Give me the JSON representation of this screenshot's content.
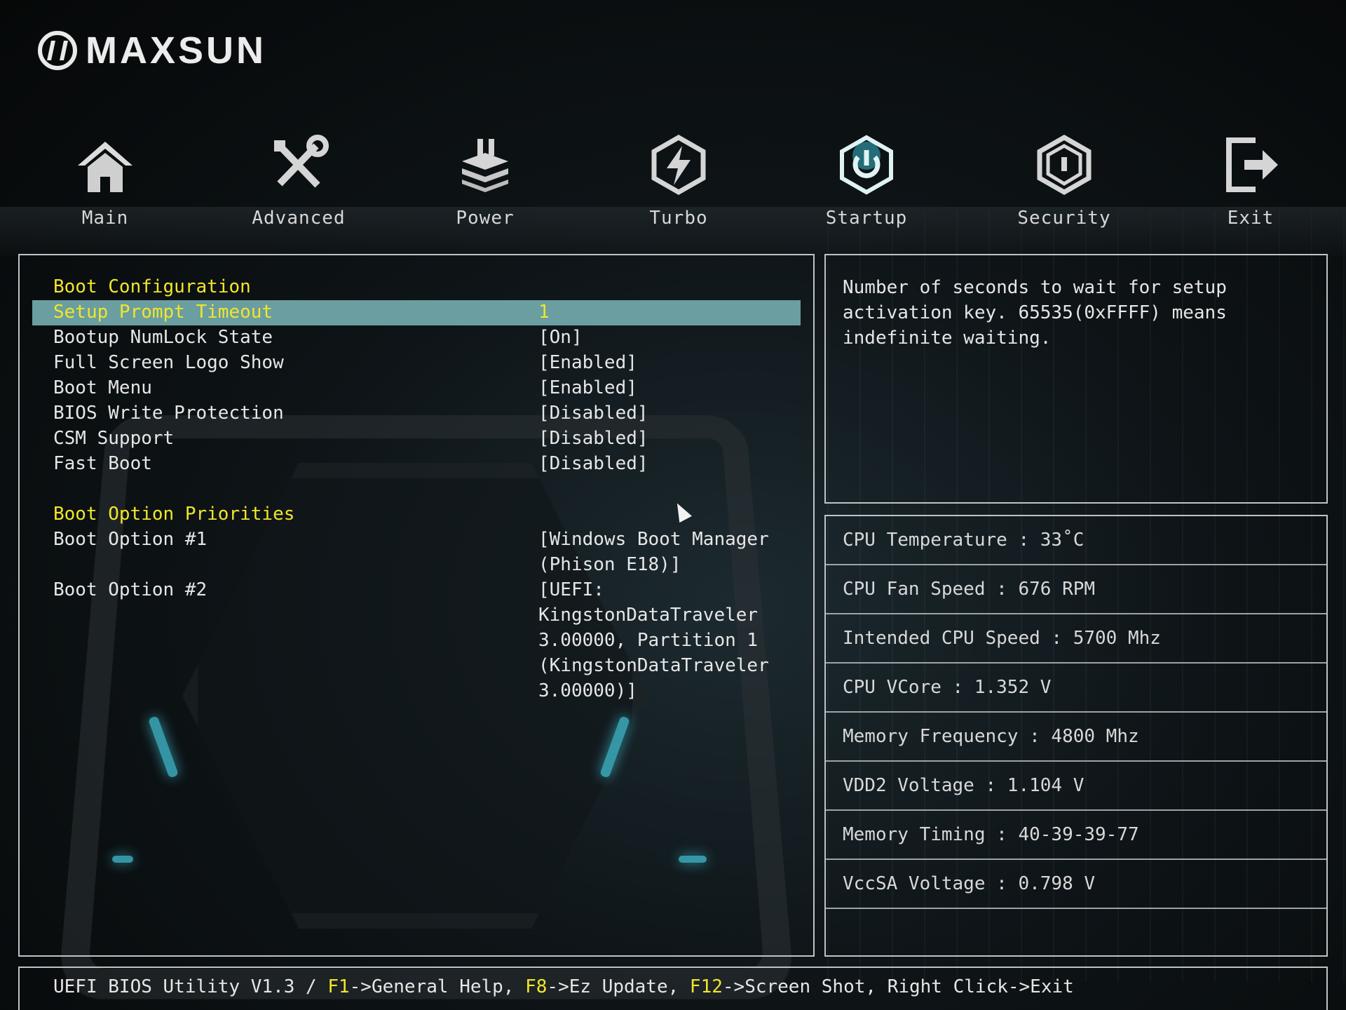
{
  "brand": "MAXSUN",
  "nav": {
    "items": [
      {
        "label": "Main",
        "icon": "home-icon"
      },
      {
        "label": "Advanced",
        "icon": "tools-icon"
      },
      {
        "label": "Power",
        "icon": "power-icon"
      },
      {
        "label": "Turbo",
        "icon": "turbo-icon"
      },
      {
        "label": "Startup",
        "icon": "startup-icon",
        "active": true
      },
      {
        "label": "Security",
        "icon": "security-icon"
      },
      {
        "label": "Exit",
        "icon": "exit-icon"
      }
    ],
    "active_color": "#39b7c9"
  },
  "main": {
    "section_boot_config": "Boot Configuration",
    "section_boot_priorities": "Boot Option Priorities",
    "settings": [
      {
        "label": "Setup Prompt Timeout",
        "value": "1"
      },
      {
        "label": "Bootup NumLock State",
        "value": "[On]"
      },
      {
        "label": "Full Screen Logo Show",
        "value": "[Enabled]"
      },
      {
        "label": "Boot Menu",
        "value": "[Enabled]"
      },
      {
        "label": "BIOS Write Protection",
        "value": "[Disabled]"
      },
      {
        "label": "CSM Support",
        "value": "[Disabled]"
      },
      {
        "label": "Fast Boot",
        "value": "[Disabled]"
      }
    ],
    "boot_options": [
      {
        "label": "Boot Option #1",
        "value_lines": [
          "[Windows Boot Manager",
          "(Phison E18)]"
        ]
      },
      {
        "label": "Boot Option #2",
        "value_lines": [
          "[UEFI:",
          "KingstonDataTraveler",
          "3.00000, Partition 1",
          "(KingstonDataTraveler",
          "3.00000)]"
        ]
      }
    ]
  },
  "help": {
    "lines": [
      "Number of seconds to wait for setup",
      "activation key. 65535(0xFFFF) means",
      "indefinite waiting."
    ]
  },
  "stats": [
    "CPU Temperature : 33˚C",
    "CPU Fan Speed : 676 RPM",
    "Intended CPU Speed : 5700 Mhz",
    "CPU VCore : 1.352 V",
    "Memory Frequency : 4800 Mhz",
    "VDD2 Voltage : 1.104 V",
    "Memory Timing : 40-39-39-77",
    "VccSA Voltage : 0.798 V"
  ],
  "footer": {
    "prefix": "UEFI BIOS Utility V1.3 / ",
    "f1_key": "F1",
    "f1_action": "->General Help, ",
    "f8_key": "F8",
    "f8_action": "->Ez Update, ",
    "f12_key": "F12",
    "f12_action": "->Screen Shot, Right Click->Exit"
  },
  "colors": {
    "highlight_bg": "#6b9ea0",
    "section_text": "#f0e62a",
    "panel_border": "#bfc3c5"
  }
}
